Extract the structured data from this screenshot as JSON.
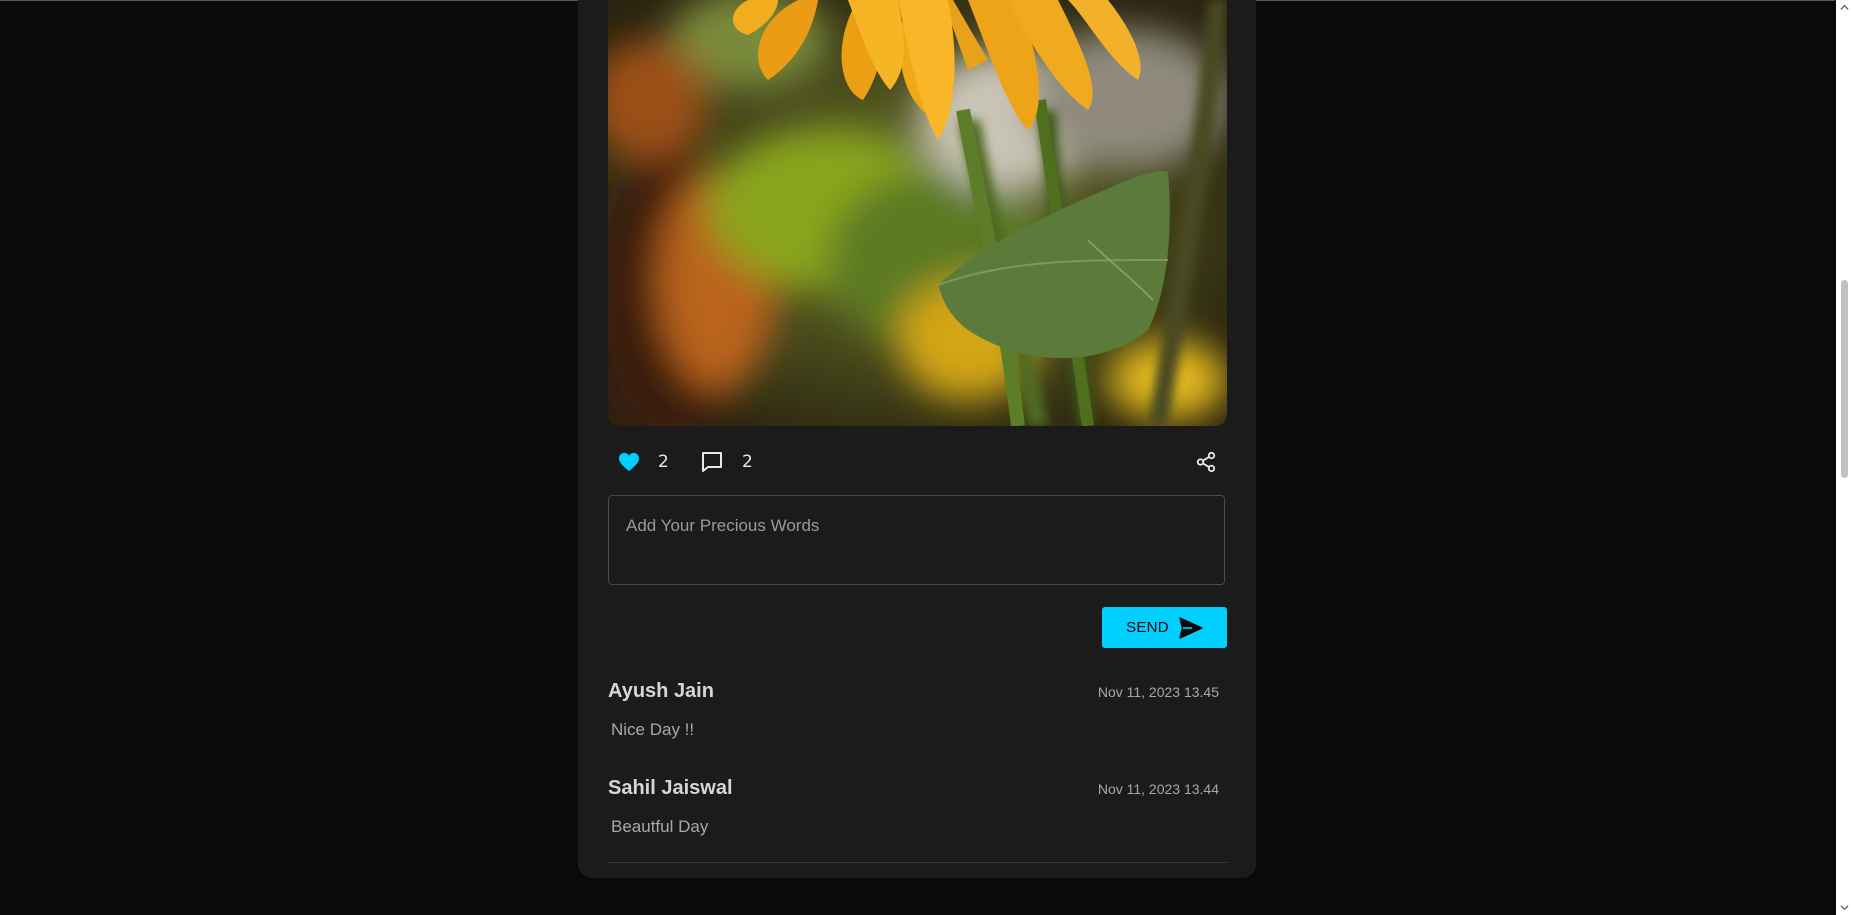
{
  "post": {
    "image_alt": "Sunflower close-up",
    "likes": "2",
    "comments_count": "2"
  },
  "composer": {
    "placeholder": "Add Your Precious Words",
    "send_label": "SEND"
  },
  "comments": [
    {
      "author": "Ayush Jain",
      "time": "Nov 11, 2023 13.45",
      "text": "Nice Day !!"
    },
    {
      "author": "Sahil Jaiswal",
      "time": "Nov 11, 2023 13.44",
      "text": "Beautful Day"
    }
  ],
  "icons": {
    "like": "heart-icon",
    "comment": "comment-icon",
    "share": "share-icon",
    "send": "send-icon"
  },
  "colors": {
    "accent": "#00cfff",
    "page_bg": "#0a0a0a",
    "card_bg": "#1b1b1b"
  }
}
